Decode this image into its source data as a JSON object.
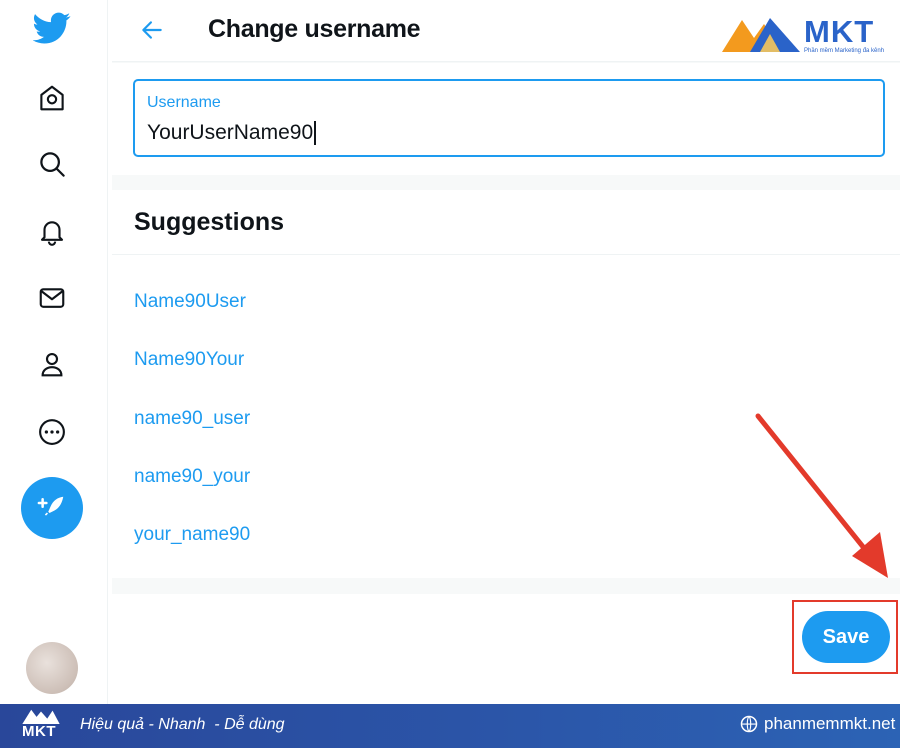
{
  "header": {
    "title": "Change username"
  },
  "brand": {
    "name": "MKT",
    "tagline": "Phần mềm Marketing đa kênh"
  },
  "input": {
    "label": "Username",
    "value": "YourUserName90"
  },
  "suggestions": {
    "title": "Suggestions",
    "items": [
      "Name90User",
      "Name90Your",
      "name90_user",
      "name90_your",
      "your_name90"
    ]
  },
  "actions": {
    "save_label": "Save"
  },
  "sidebar": {
    "icons": [
      "twitter-bird-icon",
      "home-icon",
      "search-icon",
      "bell-icon",
      "mail-icon",
      "profile-icon",
      "more-icon",
      "compose-tweet-icon"
    ]
  },
  "banner": {
    "logo_text": "MKT",
    "slogan": "Hiệu quả - Nhanh  - Dễ dùng",
    "website": "phanmemmkt.net"
  },
  "colors": {
    "accent": "#1d9bf0",
    "highlight": "#e33a2b",
    "banner": "#2b55a8",
    "text": "#0f1419"
  }
}
